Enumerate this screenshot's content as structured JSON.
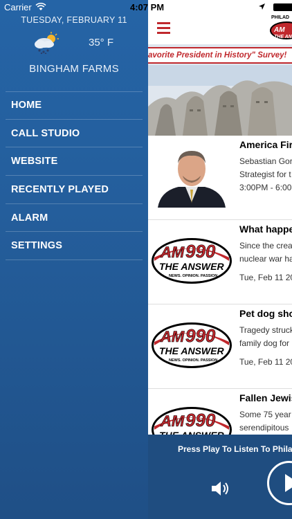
{
  "status_bar": {
    "carrier": "Carrier",
    "time": "4:07 PM"
  },
  "drawer": {
    "date": "TUESDAY, FEBRUARY 11",
    "weather_icon": "snow-cloud-sun-icon",
    "temperature": "35° F",
    "location": "BINGHAM FARMS",
    "menu": [
      "HOME",
      "CALL STUDIO",
      "WEBSITE",
      "RECENTLY PLAYED",
      "ALARM",
      "SETTINGS"
    ]
  },
  "header": {
    "menu_icon": "hamburger-icon",
    "logo_top": "PHILAD",
    "logo_main": "AM"
  },
  "banner": {
    "text": "avorite President in History\" Survey!"
  },
  "feed": [
    {
      "title": "America Fir",
      "desc": [
        "Sebastian Gor",
        "Strategist for t",
        "3:00PM - 6:00"
      ],
      "date": "",
      "thumb": "person-photo"
    },
    {
      "title": "What happe",
      "desc": [
        "Since the crea",
        "nuclear war ha"
      ],
      "date": "Tue, Feb 11 20",
      "thumb": "am990-logo"
    },
    {
      "title": "Pet dog sho",
      "desc": [
        "Tragedy struck",
        "family dog for"
      ],
      "date": "Tue, Feb 11 20",
      "thumb": "am990-logo"
    },
    {
      "title": "Fallen Jewis",
      "desc": [
        "Some 75 year",
        "serendipitous"
      ],
      "date": "",
      "thumb": "am990-logo"
    }
  ],
  "logo_text": {
    "am": "AM",
    "num": "990",
    "answer": "THE ANSWER",
    "tag": "NEWS. OPINION. PASSION."
  },
  "player": {
    "text": "Press Play To Listen To Philad"
  },
  "colors": {
    "drawer": "#245e9c",
    "accent": "#c0282d",
    "player": "#1f4d80"
  }
}
